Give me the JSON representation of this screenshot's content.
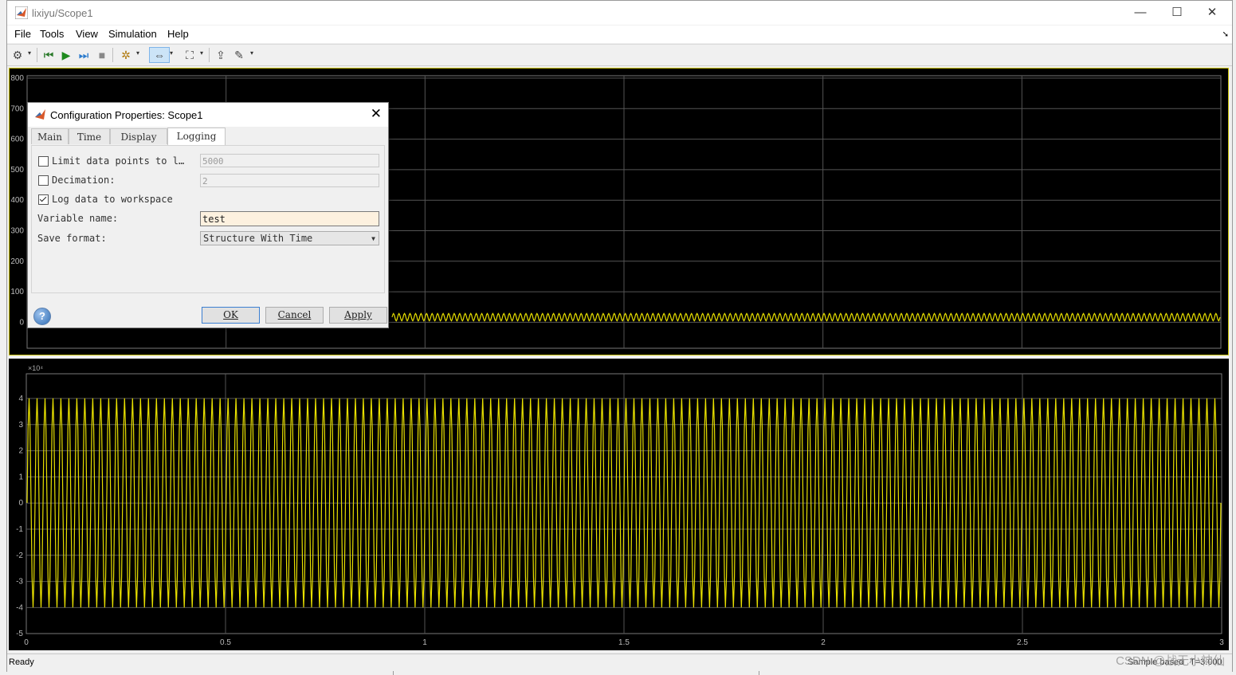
{
  "window": {
    "title": "lixiyu/Scope1",
    "controls": {
      "minimize": "—",
      "maximize": "☐",
      "close": "✕"
    }
  },
  "menu": {
    "items": [
      "File",
      "Tools",
      "View",
      "Simulation",
      "Help"
    ]
  },
  "toolbar": {
    "icons": [
      "gear-icon",
      "step-back-icon",
      "run-icon",
      "step-forward-icon",
      "stop-icon",
      "highlight-icon",
      "zoom-icon",
      "fit-to-view-icon",
      "measurements-icon",
      "style-icon"
    ]
  },
  "dialog": {
    "title": "Configuration Properties: Scope1",
    "tabs": [
      "Main",
      "Time",
      "Display",
      "Logging"
    ],
    "active_tab": "Logging",
    "limit_label": "Limit data points to l…",
    "limit_checked": false,
    "limit_value": "5000",
    "decimation_label": "Decimation:",
    "decimation_checked": false,
    "decimation_value": "2",
    "log_label": "Log data to workspace",
    "log_checked": true,
    "varname_label": "Variable name:",
    "varname_value": "test",
    "format_label": "Save format:",
    "format_value": "Structure With Time",
    "ok": "OK",
    "cancel": "Cancel",
    "apply": "Apply",
    "help": "?"
  },
  "status": {
    "left": "Ready",
    "sample": "Sample based",
    "time": "T=3.000"
  },
  "watermark": "CSDN @战无小神仙",
  "chart_data": [
    {
      "type": "line",
      "title": "",
      "xlim": [
        0,
        3
      ],
      "ylim": [
        -50,
        820
      ],
      "yticks": [
        "800",
        "700",
        "600",
        "500",
        "400",
        "300",
        "200",
        "100",
        "0"
      ],
      "xticks": [],
      "series": [
        {
          "color": "#e8e000",
          "description_values": {
            "mean": 0,
            "amplitude": 12,
            "cycles": 150
          }
        }
      ],
      "grid": true
    },
    {
      "type": "line",
      "title": "",
      "exponent": "×10⁴",
      "xlim": [
        0,
        3
      ],
      "ylim": [
        -5,
        5
      ],
      "yticks": [
        "4",
        "3",
        "2",
        "1",
        "0",
        "-1",
        "-2",
        "-3",
        "-4",
        "-5"
      ],
      "xticks": [
        "0",
        "0.5",
        "1",
        "1.5",
        "2",
        "2.5",
        "3"
      ],
      "series": [
        {
          "color": "#e8e000",
          "description_values": {
            "mean": 0,
            "amplitude": 4,
            "cycles": 150
          }
        }
      ],
      "grid": true
    }
  ]
}
